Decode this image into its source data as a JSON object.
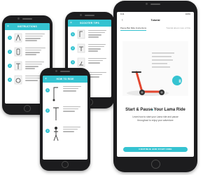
{
  "phones": {
    "back_left": {
      "header": "INSTRUCTIONS",
      "close_icon": "close-icon",
      "steps": [
        "1",
        "2",
        "3",
        "4"
      ]
    },
    "back_middle": {
      "header": "SCOOTER TIPS",
      "close_icon": "close-icon",
      "steps": [
        "1",
        "2",
        "3",
        "4"
      ]
    },
    "small_front": {
      "header": "HOW TO RIDE",
      "close_icon": "close-icon",
      "steps": [
        "1",
        "2",
        "3"
      ]
    },
    "large_front": {
      "status_time": "9:41",
      "status_right": "100%",
      "back_icon": "chevron-left-icon",
      "title": "Tutorial",
      "tabs": [
        "Pause Bar Ride Instructions",
        "Tutorial about more of this"
      ],
      "illustration": "scooter-illustration",
      "pause_badge": "II",
      "heading": "Start & Pause Your Lama Ride",
      "description": "Learn how to start your Lama ride and pause throughout to enjoy your adventure",
      "button": "CONTINUE AND START RIDE"
    }
  },
  "colors": {
    "accent": "#35c3d1",
    "phone_body": "#1c1c1e",
    "scooter": "#e3462f"
  }
}
